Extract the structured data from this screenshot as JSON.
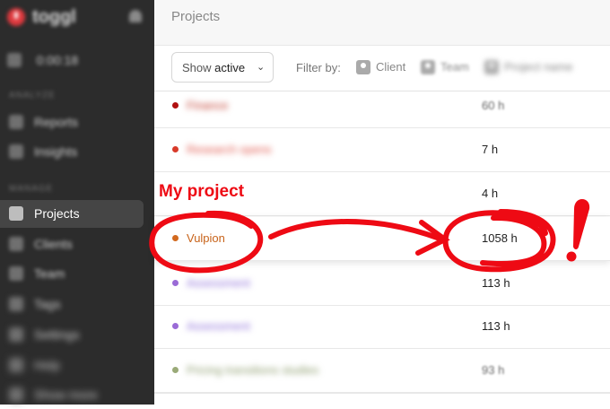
{
  "sidebar": {
    "logo_text": "toggl",
    "timer_label": "0:00:18",
    "section_analyze": "ANALYZE",
    "section_manage": "MANAGE",
    "items": [
      {
        "label": "Reports",
        "icon": "reports-icon",
        "active": false
      },
      {
        "label": "Insights",
        "icon": "insights-icon",
        "active": false
      },
      {
        "label": "Projects",
        "icon": "folder-icon",
        "active": true
      },
      {
        "label": "Clients",
        "icon": "clients-icon",
        "active": false
      },
      {
        "label": "Team",
        "icon": "team-icon",
        "active": false
      },
      {
        "label": "Tags",
        "icon": "tag-icon",
        "active": false
      },
      {
        "label": "Settings",
        "icon": "gear-icon",
        "active": false
      },
      {
        "label": "Help",
        "icon": "help-icon",
        "active": false
      },
      {
        "label": "Show more",
        "icon": "more-icon",
        "active": false
      }
    ]
  },
  "header": {
    "title": "Projects"
  },
  "filters": {
    "show_prefix": "Show",
    "show_value": "active",
    "filter_by_label": "Filter by:",
    "client_label": "Client",
    "team_label": "Team",
    "project_name_label": "Project name"
  },
  "projects": [
    {
      "name": "Finance",
      "hours": "60 h",
      "color": "#b01010"
    },
    {
      "name": "Research opens",
      "hours": "7 h",
      "color": "#d83a2a"
    },
    {
      "name": "",
      "hours": "4 h",
      "color": "#ffffff"
    },
    {
      "name": "Vulpion",
      "hours": "1058 h",
      "color": "#d2691e"
    },
    {
      "name": "Assessment",
      "hours": "113 h",
      "color": "#9a6bd6"
    },
    {
      "name": "Assessment",
      "hours": "113 h",
      "color": "#9a6bd6"
    },
    {
      "name": "Pricing transitions studies",
      "hours": "93 h",
      "color": "#9aaa78"
    }
  ],
  "annotation": {
    "label": "My project",
    "exclamation": "!",
    "color": "#ee0a14"
  }
}
